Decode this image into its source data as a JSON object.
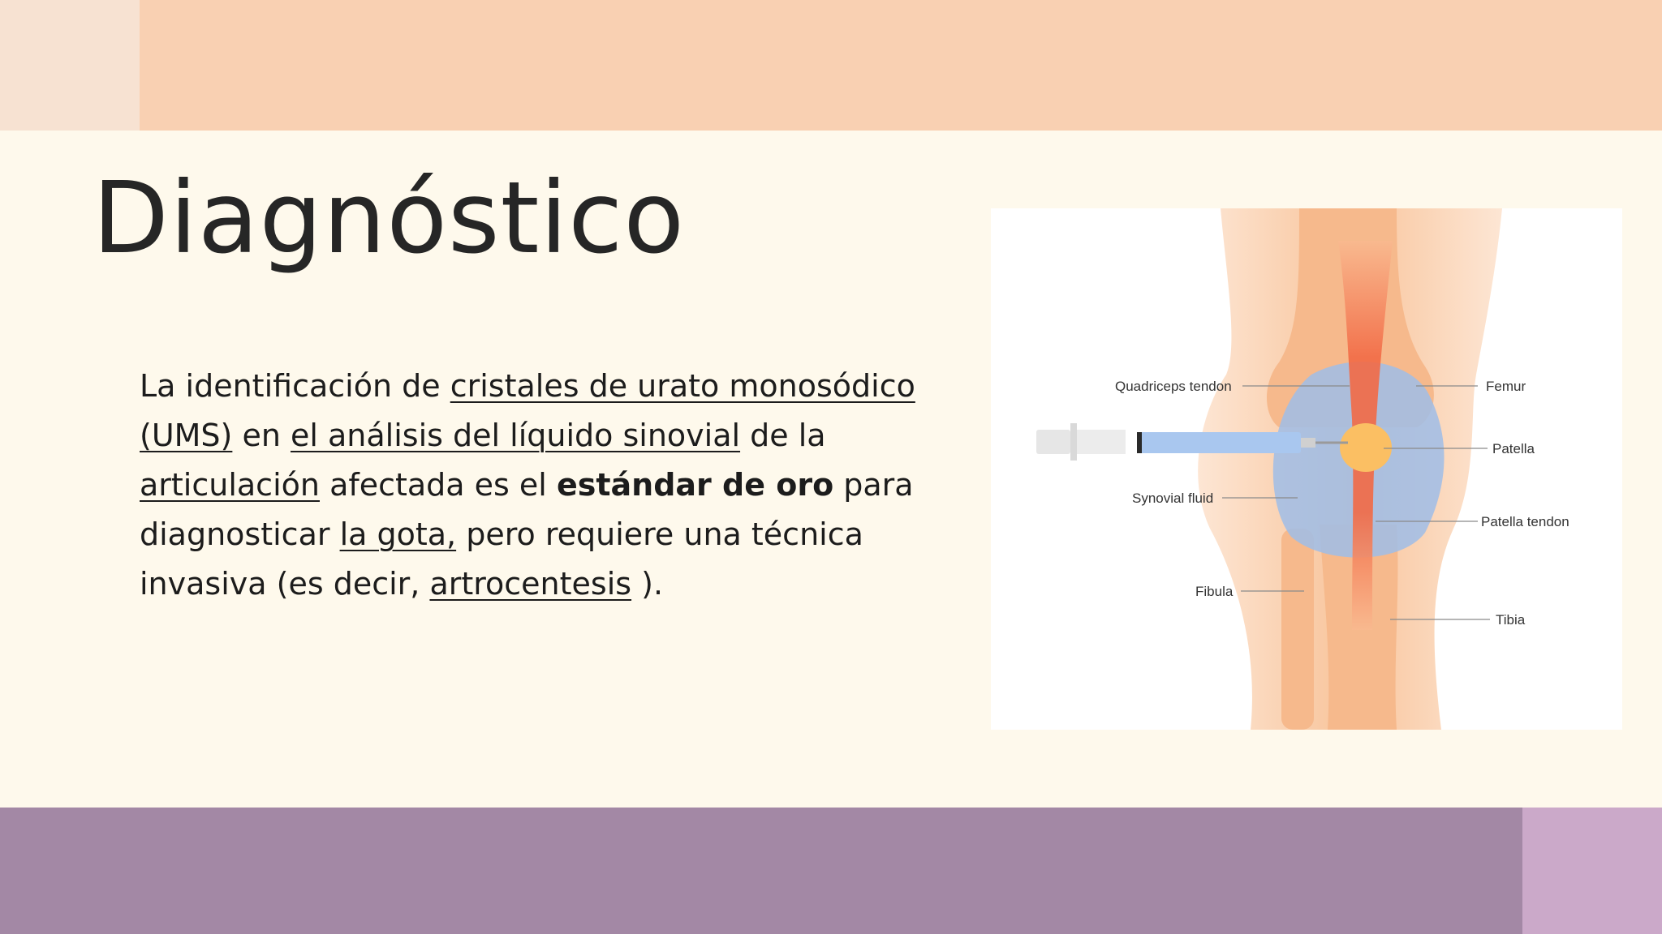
{
  "slide": {
    "title": "Diagnóstico",
    "body": {
      "s1": "La identificación de ",
      "l1": "cristales de urato monosódico (UMS)",
      "s2": " en ",
      "l2": "el análisis del líquido sinovial",
      "s3": " de la ",
      "l3": "articulación",
      "s4": " afectada es el ",
      "bold": "estándar de oro",
      "s5": " para diagnosticar ",
      "l4": "la gota,",
      "s6": " pero requiere una técnica invasiva (es decir, ",
      "l5": "artrocentesis",
      "s7": " )."
    }
  },
  "figure": {
    "labels": {
      "quadriceps": "Quadriceps tendon",
      "femur": "Femur",
      "patella": "Patella",
      "synovial": "Synovial fluid",
      "patella_tendon": "Patella tendon",
      "fibula": "Fibula",
      "tibia": "Tibia"
    }
  },
  "colors": {
    "background": "#fef9ec",
    "top_band": "#f9d0b2",
    "top_corner": "#f7e2d2",
    "bottom_band": "#a388a5",
    "bottom_corner": "#cba9c9"
  }
}
